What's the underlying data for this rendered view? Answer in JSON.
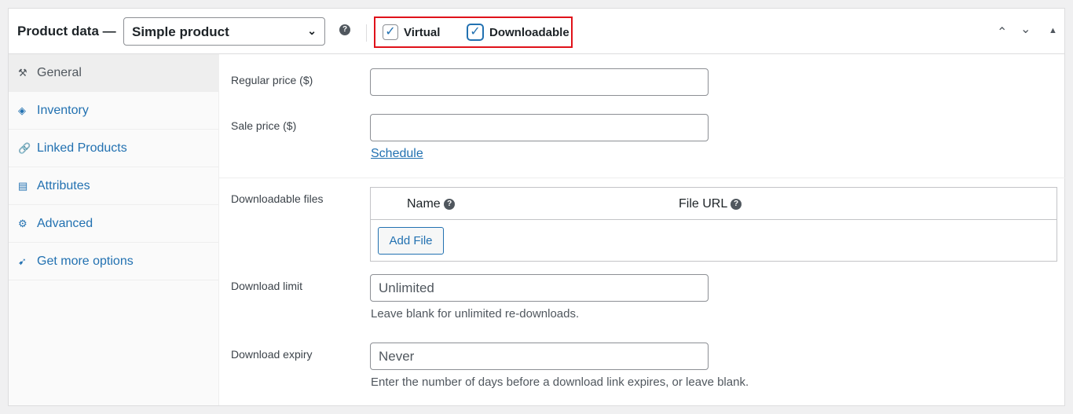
{
  "header": {
    "title": "Product data —",
    "product_type": "Simple product",
    "virtual_label": "Virtual",
    "virtual_checked": true,
    "downloadable_label": "Downloadable",
    "downloadable_checked": true,
    "help": "?",
    "check": "✓",
    "chev_down": "⌄",
    "up": "⌃",
    "down": "⌄",
    "collapse": "▲"
  },
  "sidebar": {
    "items": [
      {
        "label": "General",
        "icon": "⚒"
      },
      {
        "label": "Inventory",
        "icon": "◈"
      },
      {
        "label": "Linked Products",
        "icon": "🔗"
      },
      {
        "label": "Attributes",
        "icon": "▤"
      },
      {
        "label": "Advanced",
        "icon": "⚙"
      },
      {
        "label": "Get more options",
        "icon": "➹"
      }
    ]
  },
  "fields": {
    "regular_price_label": "Regular price ($)",
    "sale_price_label": "Sale price ($)",
    "schedule": "Schedule",
    "downloadable_files_label": "Downloadable files",
    "col_name": "Name",
    "col_url": "File URL",
    "add_file": "Add File",
    "download_limit_label": "Download limit",
    "download_limit_placeholder": "Unlimited",
    "download_limit_hint": "Leave blank for unlimited re-downloads.",
    "download_expiry_label": "Download expiry",
    "download_expiry_placeholder": "Never",
    "download_expiry_hint": "Enter the number of days before a download link expires, or leave blank."
  }
}
